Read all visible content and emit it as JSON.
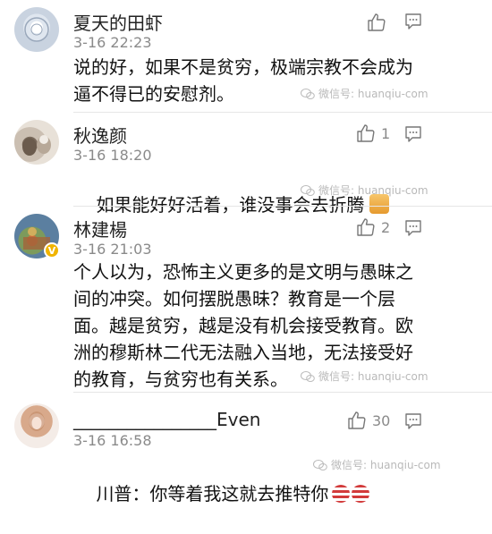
{
  "comments": [
    {
      "name": "夏天的田虾",
      "time": "3-16 22:23",
      "text": "说的好，如果不是贫穷，极端宗教不会成为\n逼不得已的安慰剂。",
      "likes": ""
    },
    {
      "name": "秋逸颜",
      "time": "3-16 18:20",
      "text": "如果能好好活着，谁没事会去折腾",
      "likes": "1"
    },
    {
      "name": "林建楊",
      "time": "3-16 21:03",
      "text": "个人以为，恐怖主义更多的是文明与愚昧之\n间的冲突。如何摆脱愚昧？教育是一个层\n面。越是贫穷，越是没有机会接受教育。欧\n洲的穆斯林二代无法融入当地，无法接受好\n的教育，与贫穷也有关系。",
      "likes": "2"
    },
    {
      "name": "________________Even",
      "time": "3-16 16:58",
      "text": "川普：你等着我这就去推特你",
      "likes": "30"
    }
  ],
  "watermark": "微信号: huanqiu-com",
  "badge_v": "V"
}
